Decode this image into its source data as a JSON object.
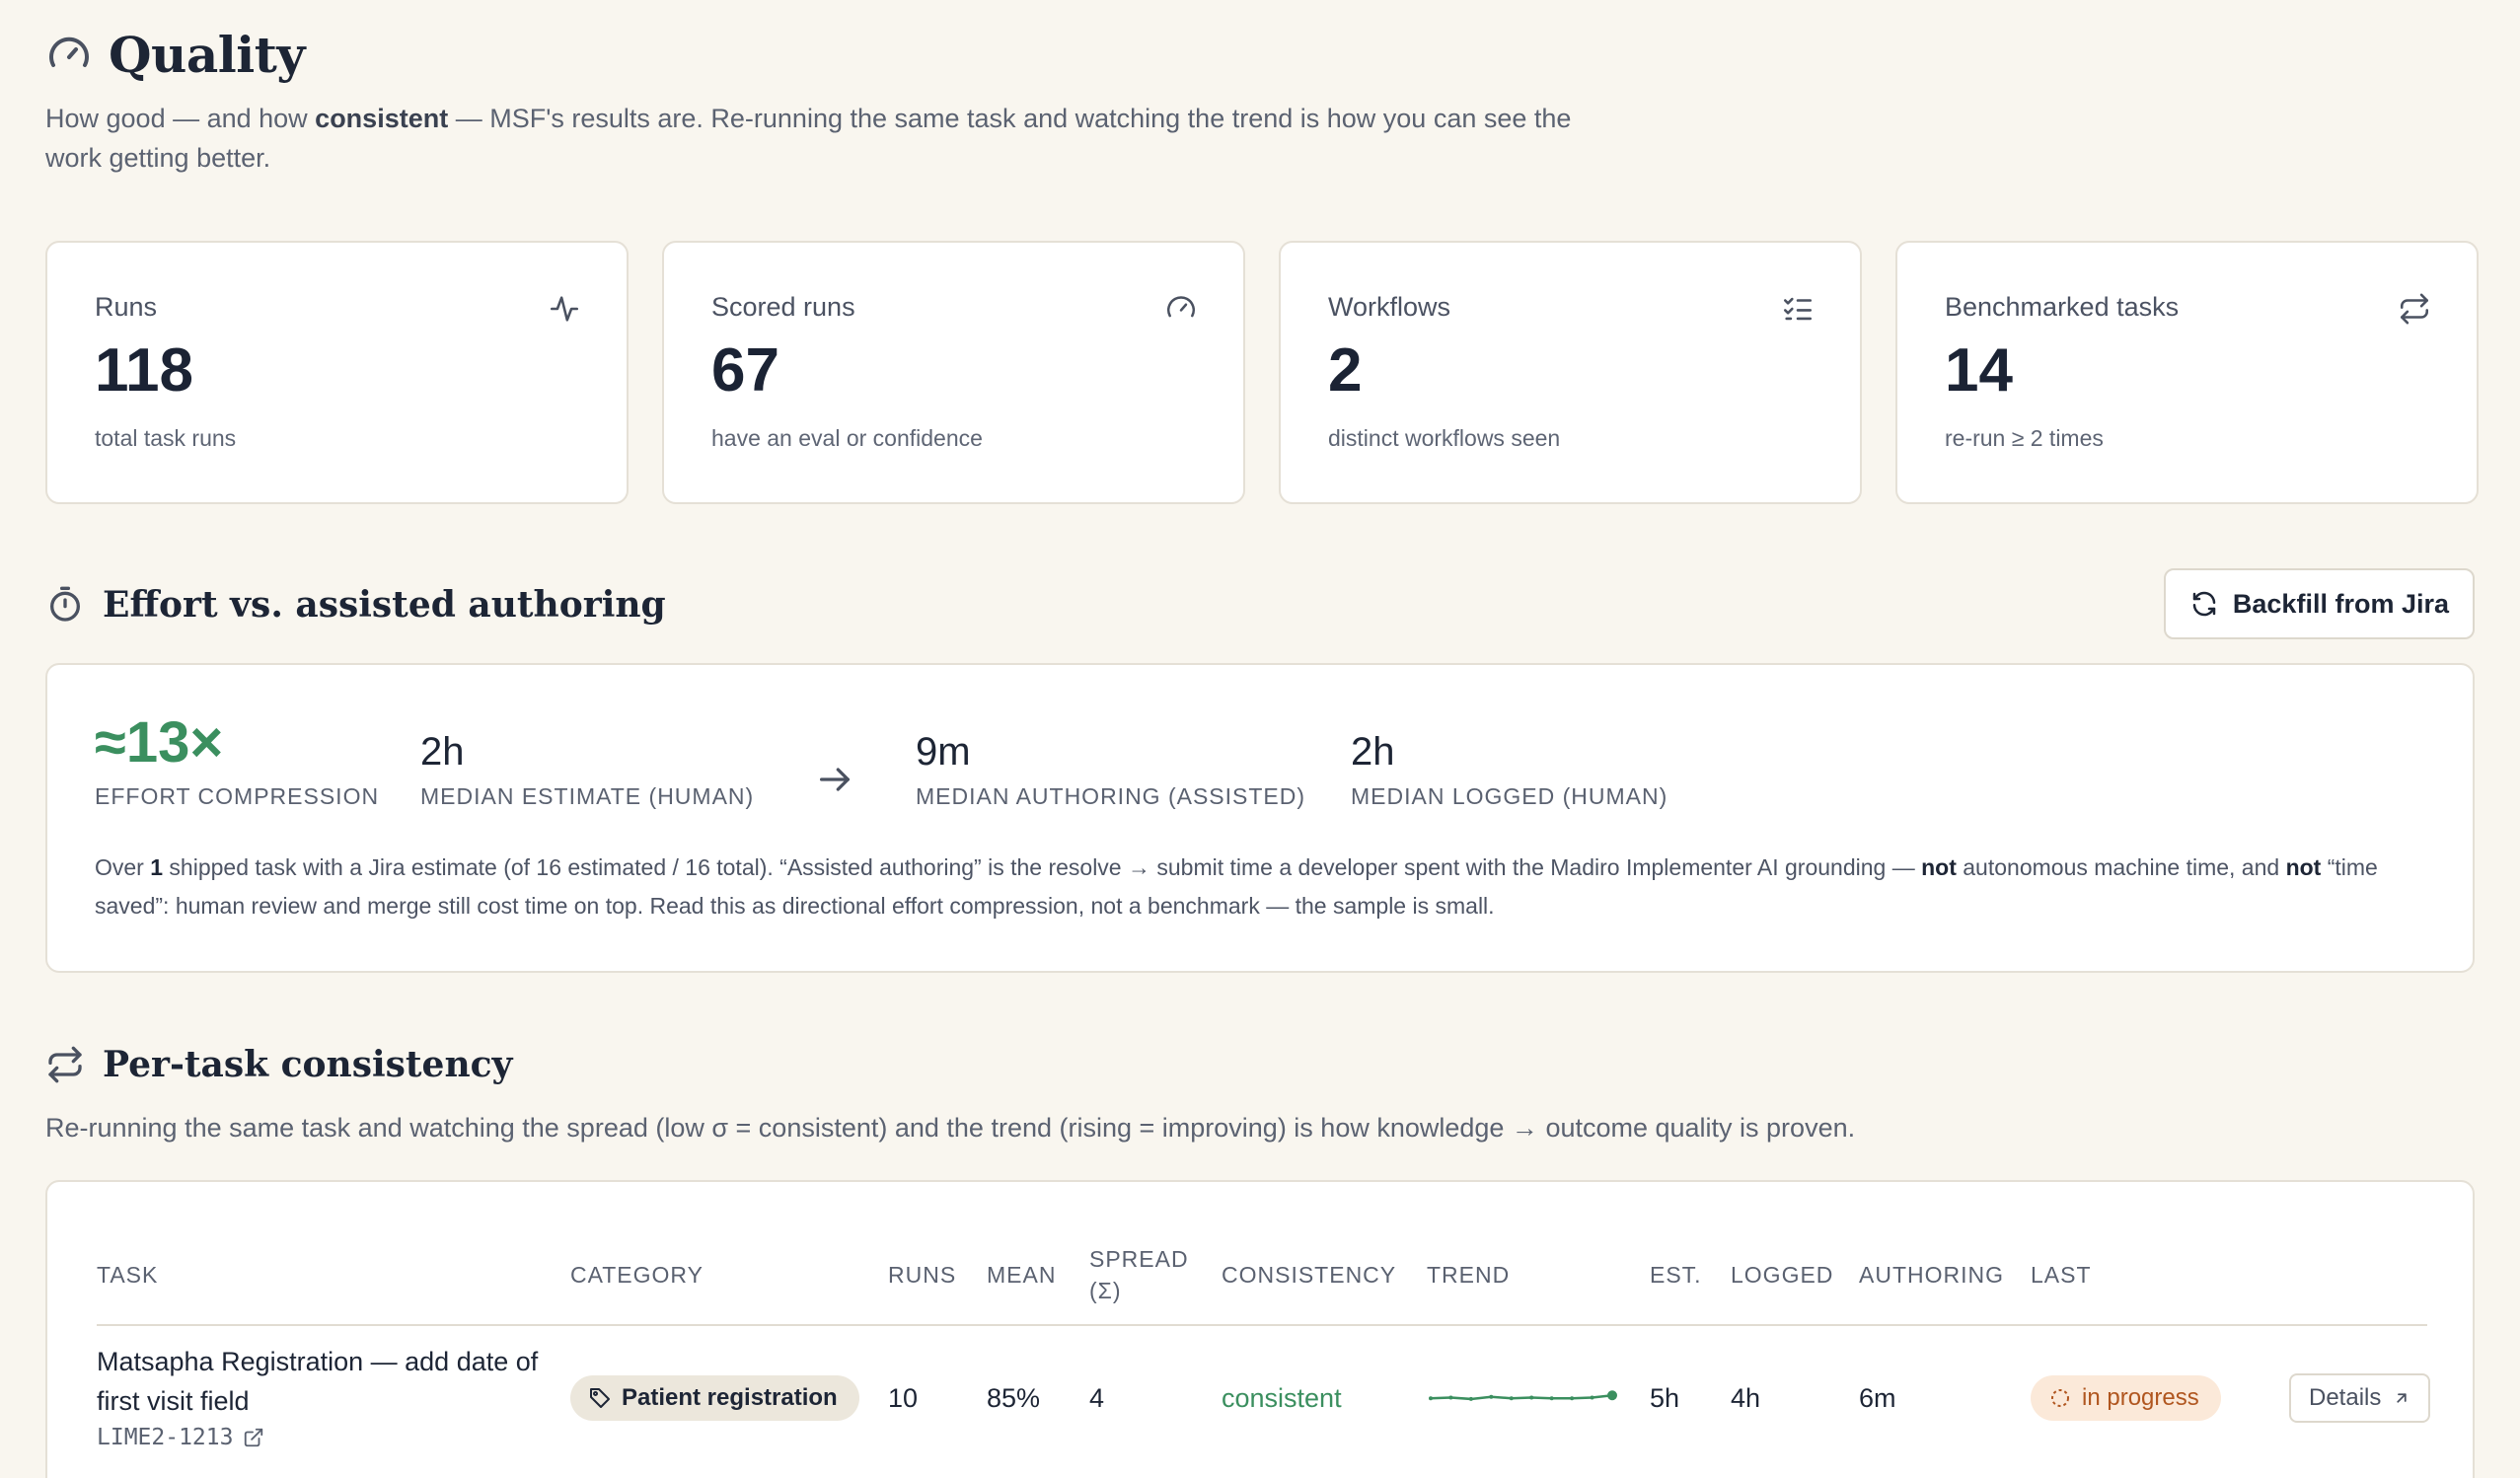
{
  "header": {
    "title": "Quality",
    "desc_pre": "How good — and how ",
    "desc_bold": "consistent",
    "desc_post": " — MSF's results are. Re-running the same task and watching the trend is how you can see the work getting better."
  },
  "cards": [
    {
      "label": "Runs",
      "value": "118",
      "sub": "total task runs",
      "icon": "activity-icon"
    },
    {
      "label": "Scored runs",
      "value": "67",
      "sub": "have an eval or confidence",
      "icon": "gauge-icon"
    },
    {
      "label": "Workflows",
      "value": "2",
      "sub": "distinct workflows seen",
      "icon": "list-checks-icon"
    },
    {
      "label": "Benchmarked tasks",
      "value": "14",
      "sub": "re-run ≥ 2 times",
      "icon": "repeat-icon"
    }
  ],
  "effort": {
    "title": "Effort vs. assisted authoring",
    "backfill_label": "Backfill from Jira",
    "compression_value": "≈13×",
    "compression_label": "Effort compression",
    "estimate_value": "2h",
    "estimate_label": "Median estimate (human)",
    "authoring_value": "9m",
    "authoring_label": "Median authoring (assisted)",
    "logged_value": "2h",
    "logged_label": "Median logged (human)",
    "note": {
      "p1": "Over ",
      "b1": "1",
      "p2": " shipped task with a Jira estimate (of 16 estimated / 16 total). “Assisted authoring” is the resolve → submit time a developer spent with the Madiro Implementer AI grounding — ",
      "b2": "not",
      "p3": " autonomous machine time, and ",
      "b3": "not",
      "p4": " “time saved”: human review and merge still cost time on top. Read this as directional effort compression, not a benchmark — the sample is small."
    }
  },
  "consistency": {
    "title": "Per-task consistency",
    "desc": "Re-running the same task and watching the spread (low σ = consistent) and the trend (rising = improving) is how knowledge → outcome quality is proven.",
    "columns": {
      "task": "Task",
      "category": "Category",
      "runs": "Runs",
      "mean": "Mean",
      "spread": "Spread (σ)",
      "consistency": "Consistency",
      "trend": "Trend",
      "est": "Est.",
      "logged": "Logged",
      "authoring": "Authoring",
      "last": "Last"
    },
    "rows": [
      {
        "task": "Matsapha Registration — add date of first visit field",
        "key": "LIME2-1213",
        "category": "Patient registration",
        "runs": "10",
        "mean": "85%",
        "spread": "4",
        "consistency": "consistent",
        "est": "5h",
        "logged": "4h",
        "authoring": "6m",
        "last": "in progress",
        "details_label": "Details",
        "trend": [
          0.82,
          0.83,
          0.81,
          0.84,
          0.82,
          0.83,
          0.82,
          0.82,
          0.83,
          0.86
        ]
      }
    ]
  },
  "colors": {
    "accent_green": "#3b8f5f",
    "status_orange": "#b0561f",
    "background": "#f9f6ef"
  }
}
